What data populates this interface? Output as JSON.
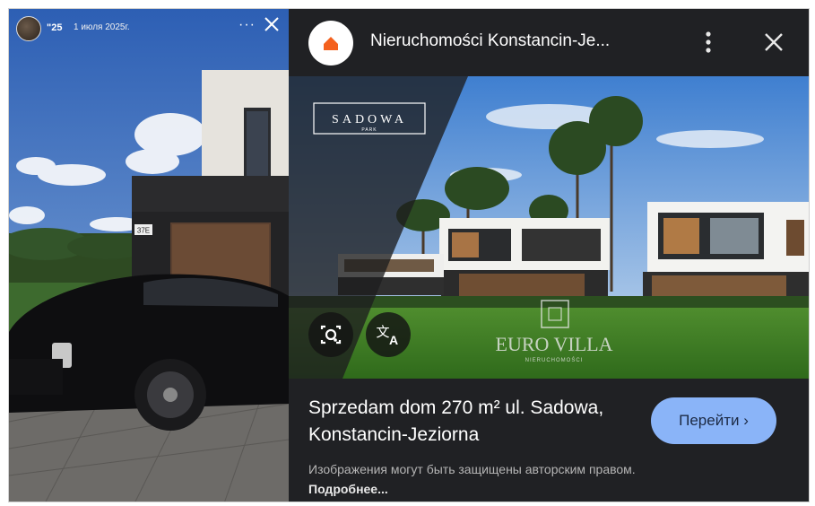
{
  "story": {
    "user": "\"25",
    "date": "1 июля 2025г.",
    "more": "···",
    "house_number": "37E"
  },
  "lens": {
    "site_title": "Nieruchomości Konstancin-Je...",
    "watermark_top": "SADOWA",
    "watermark_top_sub": "PARK",
    "watermark_center": "EURO VILLA",
    "watermark_center_sub": "NIERUCHOMOŚCI",
    "result_title": "Sprzedam dom 270 m² ul. Sadowa, Konstancin-Jeziorna",
    "go_button": "Перейти",
    "disclaimer": "Изображения могут быть защищены авторским правом.",
    "disclaimer_link": "Подробнее...",
    "accent": "#8ab4f8",
    "site_icon_color": "#f4611e"
  }
}
